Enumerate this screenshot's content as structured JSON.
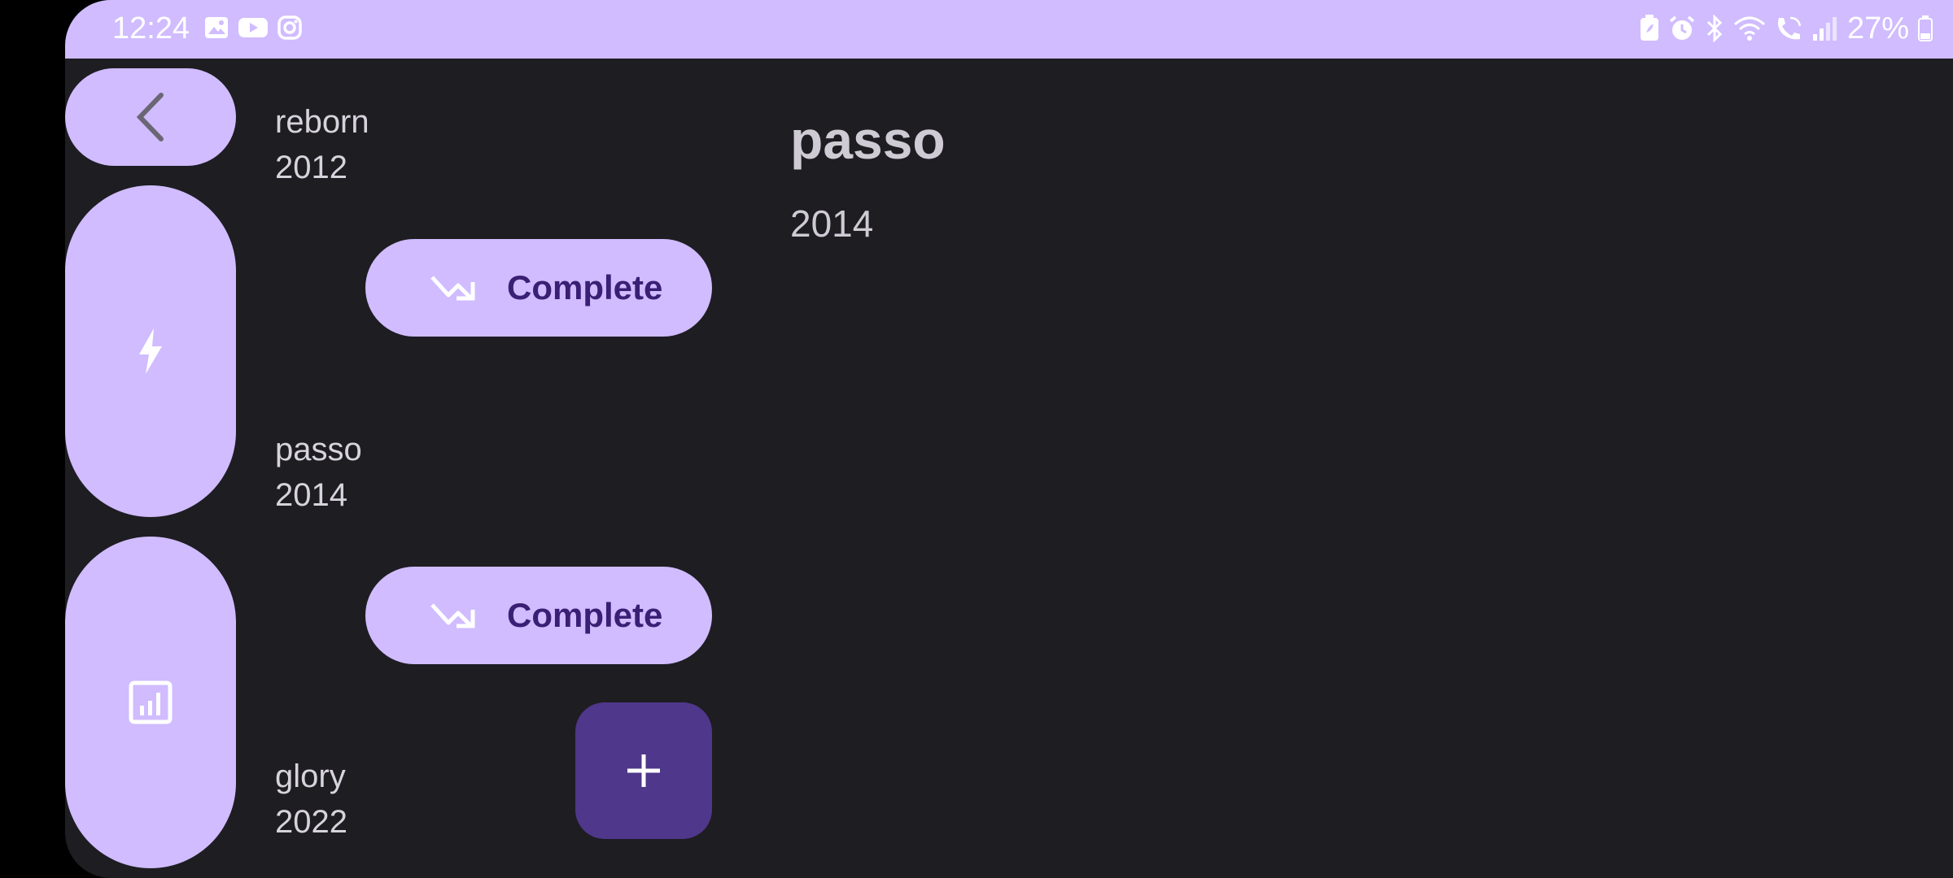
{
  "status_bar": {
    "time": "12:24",
    "left_icons": [
      "gallery-icon",
      "youtube-icon",
      "instagram-icon"
    ],
    "right_icons": [
      "battery-saver-icon",
      "alarm-icon",
      "bluetooth-icon",
      "wifi-icon",
      "wifi-calling-icon",
      "signal-icon"
    ],
    "battery": "27%"
  },
  "rail": {
    "items": [
      {
        "icon": "back-arrow-icon"
      },
      {
        "icon": "lightning-icon"
      },
      {
        "icon": "stats-icon"
      }
    ]
  },
  "list": {
    "items": [
      {
        "title": "reborn",
        "year": "2012"
      },
      {
        "title": "passo",
        "year": "2014"
      },
      {
        "title": "glory",
        "year": "2022"
      }
    ],
    "complete_label": "Complete"
  },
  "fab": {
    "icon": "plus-icon"
  },
  "detail": {
    "title": "passo",
    "year": "2014"
  },
  "colors": {
    "accent": "#d0bcff",
    "accent_text": "#3a1f74",
    "fab": "#4f378b",
    "background": "#1e1d22"
  }
}
